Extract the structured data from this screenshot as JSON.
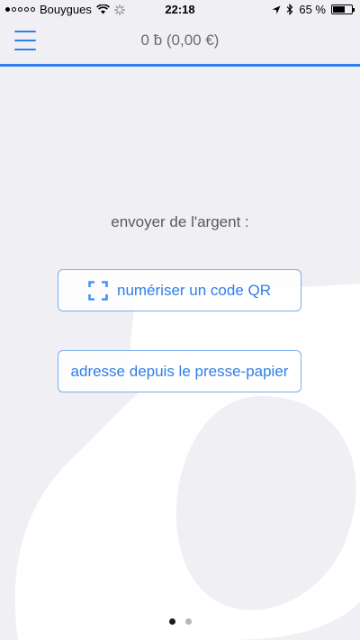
{
  "status_bar": {
    "carrier": "Bouygues",
    "time": "22:18",
    "battery": "65 %",
    "battery_level": 0.65,
    "signal_bars_filled": 1,
    "signal_bars_total": 5
  },
  "header": {
    "balance": "0 ƀ (0,00 €)",
    "accent_color": "#2f7ee8"
  },
  "main": {
    "prompt": "envoyer de l'argent :",
    "scan_qr_label": "numériser un code QR",
    "clipboard_label": "adresse depuis le presse-papier"
  },
  "pager": {
    "total": 2,
    "active": 1
  },
  "icons": {
    "menu": "hamburger-icon",
    "qr": "qr-scan-icon",
    "wifi": "wifi-icon",
    "location": "location-arrow-icon",
    "bluetooth": "bluetooth-icon",
    "battery": "battery-icon"
  }
}
